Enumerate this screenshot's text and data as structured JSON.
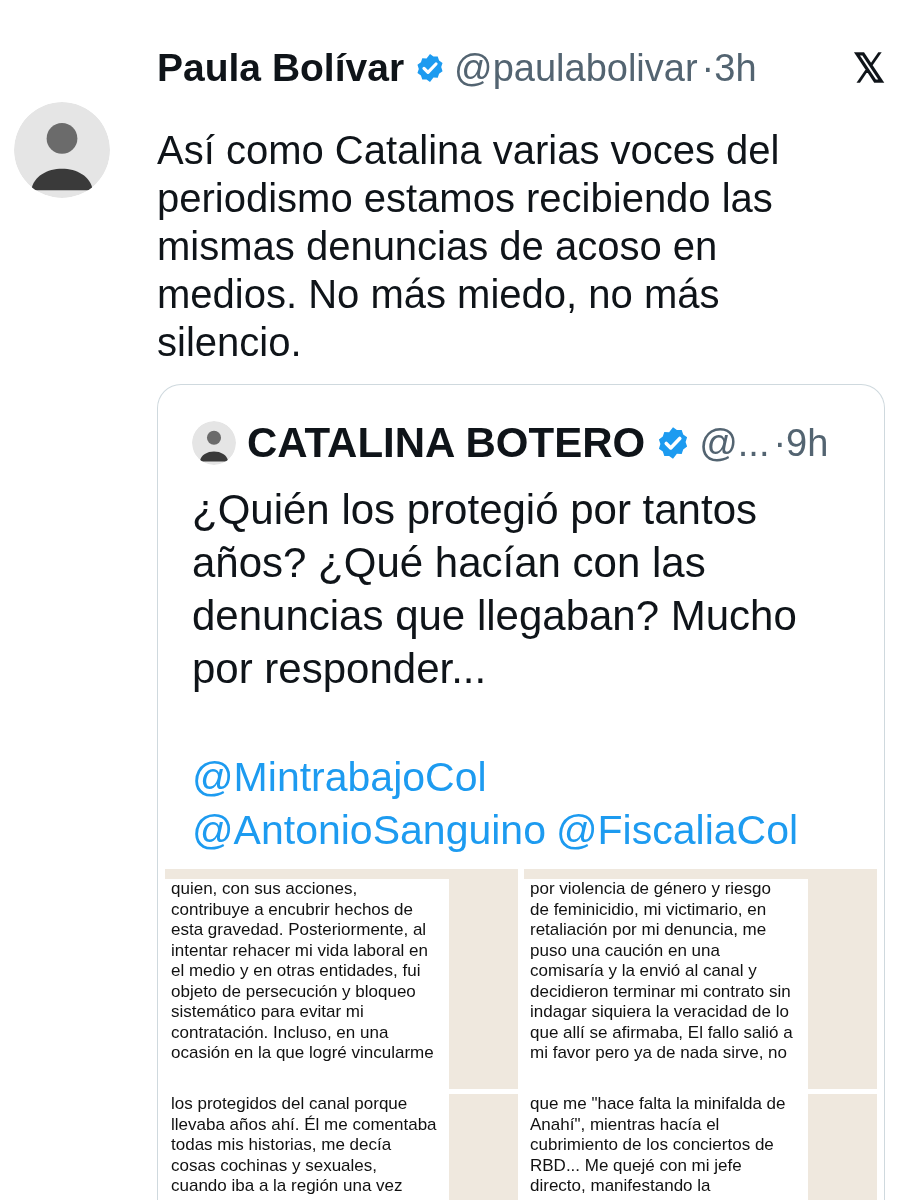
{
  "tweet": {
    "name": "Paula Bolívar",
    "verified": true,
    "handle": "@paulabolivar",
    "separator": "·",
    "time": "3h",
    "logo": "𝕏",
    "text": [
      "Así como Catalina varias voces del",
      "periodismo estamos recibiendo las",
      "mismas denuncias de acoso en",
      "medios. No más miedo, no más",
      "silencio."
    ],
    "quote": {
      "name": "CATALINA BOTERO",
      "verified": true,
      "handle": "@...",
      "separator": "·",
      "time": "9h",
      "text": [
        "¿Quién los protegió por tantos",
        "años? ¿Qué hacían con las",
        "denuncias que llegaban? Mucho",
        "por responder..."
      ],
      "mentions": [
        [
          "@MintrabajoCol"
        ],
        [
          "@AntonioSanguino",
          "@FiscaliaCol"
        ]
      ],
      "images": [
        {
          "lines": [
            "quien, con sus acciones,",
            "contribuye a encubrir hechos de",
            "esta gravedad. Posteriormente, al",
            "intentar rehacer mi vida laboral en",
            "el medio y en otras entidades, fui",
            "objeto de persecución y bloqueo",
            "sistemático para evitar mi",
            "contratación. Incluso, en una",
            "ocasión en la que logré vincularme"
          ]
        },
        {
          "lines": [
            "por violencia de género y riesgo",
            "de feminicidio, mi victimario, en",
            "retaliación por mi denuncia, me",
            "puso una caución en una",
            "comisaría y la envió al canal y",
            "decidieron terminar mi contrato sin",
            "indagar siquiera la veracidad de lo",
            "que allí se afirmaba, El fallo salió a",
            "mi favor pero ya de nada sirve, no"
          ]
        },
        {
          "lines": [
            "los protegidos del canal porque",
            "llevaba años ahí. Él me comentaba",
            "todas mis historias, me decía",
            "cosas cochinas y sexuales,",
            "cuando iba a la región una vez"
          ]
        },
        {
          "lines": [
            "que me \"hace falta la minifalda de",
            "Anahí\", mientras hacía el",
            "cubrimiento de los conciertos de",
            "RBD... Me quejé con mi jefe",
            "directo, manifestando la"
          ]
        }
      ]
    }
  }
}
